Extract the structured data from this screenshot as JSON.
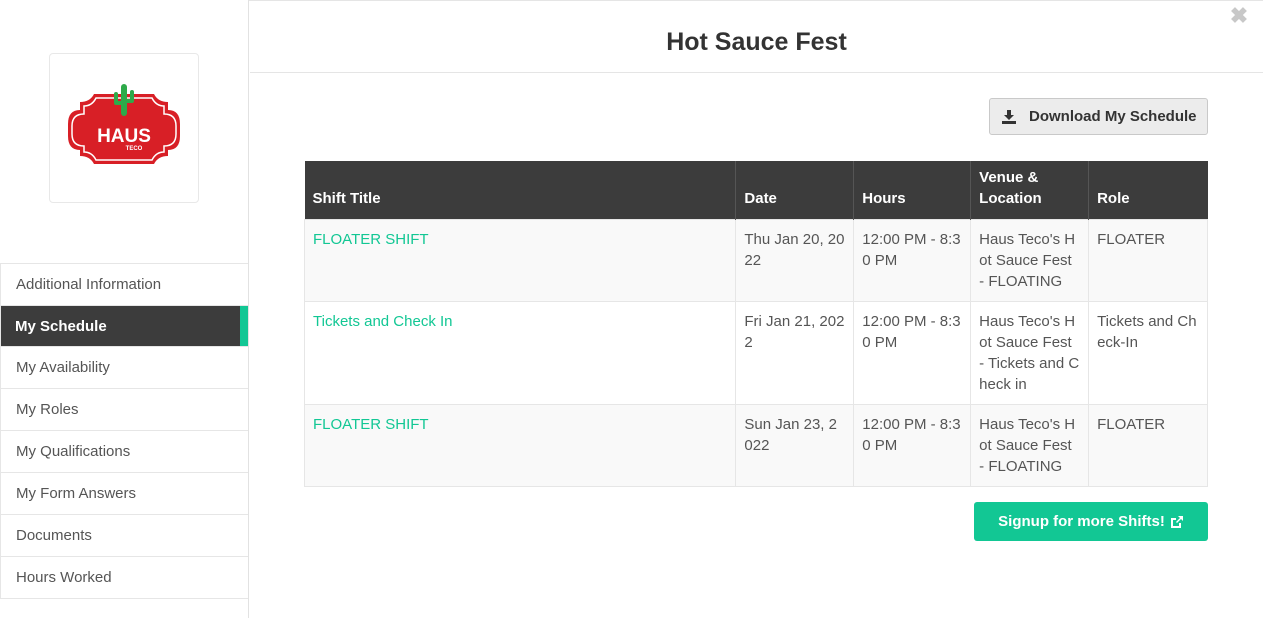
{
  "event": {
    "title": "Hot Sauce Fest"
  },
  "logo": {
    "line1": "HAUS",
    "line2": "TECO"
  },
  "sidebar": {
    "items": [
      {
        "label": "Additional Information",
        "active": false
      },
      {
        "label": "My Schedule",
        "active": true
      },
      {
        "label": "My Availability",
        "active": false
      },
      {
        "label": "My Roles",
        "active": false
      },
      {
        "label": "My Qualifications",
        "active": false
      },
      {
        "label": "My Form Answers",
        "active": false
      },
      {
        "label": "Documents",
        "active": false
      },
      {
        "label": "Hours Worked",
        "active": false
      }
    ]
  },
  "toolbar": {
    "download_label": "Download My Schedule"
  },
  "table": {
    "headers": [
      "Shift Title",
      "Date",
      "Hours",
      "Venue & Location",
      "Role"
    ],
    "rows": [
      [
        "FLOATER SHIFT",
        "Thu Jan 20, 2022",
        "12:00 PM - 8:30 PM",
        "Haus Teco's Hot Sauce Fest - FLOATING",
        "FLOATER"
      ],
      [
        "Tickets and Check In",
        "Fri Jan 21, 2022",
        "12:00 PM - 8:30 PM",
        "Haus Teco's Hot Sauce Fest - Tickets and Check in",
        "Tickets and Check-In"
      ],
      [
        "FLOATER SHIFT",
        "Sun Jan 23, 2022",
        "12:00 PM - 8:30 PM",
        "Haus Teco's Hot Sauce Fest - FLOATING",
        "FLOATER"
      ]
    ]
  },
  "actions": {
    "signup_label": "Signup for more Shifts!"
  },
  "colors": {
    "accent": "#12c794",
    "dark": "#3c3c3c",
    "logo_red": "#d81f26",
    "logo_green": "#2eaa4a"
  },
  "icons": {
    "close": "close-icon",
    "download": "download-icon",
    "external": "external-link-icon"
  }
}
